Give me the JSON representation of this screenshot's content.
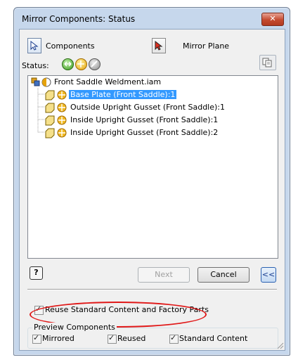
{
  "window": {
    "title": "Mirror Components: Status",
    "close_symbol": "✕"
  },
  "selectors": {
    "components_label": "Components",
    "mirror_plane_label": "Mirror Plane"
  },
  "status": {
    "label": "Status:"
  },
  "tree": {
    "root": "Front Saddle Weldment.iam",
    "items": [
      "Base Plate (Front Saddle):1",
      "Outside Upright Gusset (Front Saddle):1",
      "Inside Upright Gusset (Front Saddle):1",
      "Inside Upright Gusset (Front Saddle):2"
    ]
  },
  "buttons": {
    "help": "?",
    "next": "Next",
    "cancel": "Cancel",
    "more": "<<"
  },
  "options": {
    "reuse_label": "Reuse Standard Content and Factory Parts",
    "reuse_checked": true
  },
  "preview": {
    "title": "Preview Components",
    "mirrored": "Mirrored",
    "reused": "Reused",
    "standard": "Standard Content"
  },
  "colors": {
    "title_bg": "#c6d7ec",
    "selection": "#3399ff",
    "annotation": "#e01818"
  }
}
